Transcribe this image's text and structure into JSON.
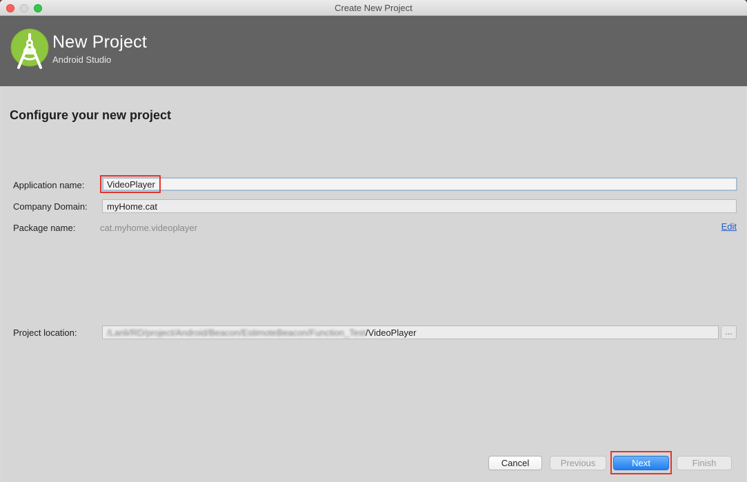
{
  "window": {
    "title": "Create New Project"
  },
  "header": {
    "title": "New Project",
    "subtitle": "Android Studio",
    "logo_icon": "android-studio-logo-icon"
  },
  "main": {
    "section_title": "Configure your new project",
    "application_name": {
      "label": "Application name:",
      "value": "VideoPlayer"
    },
    "company_domain": {
      "label": "Company Domain:",
      "value": "myHome.cat"
    },
    "package_name": {
      "label": "Package name:",
      "value": "cat.myhome.videoplayer",
      "edit_link": "Edit"
    },
    "project_location": {
      "label": "Project location:",
      "value_blurred": "/Lanli/RD/project/Android/Beacon/EstimoteBeacon/Function_Test",
      "value_suffix": "/VideoPlayer",
      "browse_label": "..."
    }
  },
  "footer": {
    "cancel": "Cancel",
    "previous": "Previous",
    "next": "Next",
    "finish": "Finish"
  },
  "colors": {
    "header_bg": "#636363",
    "logo_green": "#8ec63f",
    "highlight": "#e0352b",
    "primary_button": "#1f7ef0",
    "link": "#1e5ac8"
  }
}
